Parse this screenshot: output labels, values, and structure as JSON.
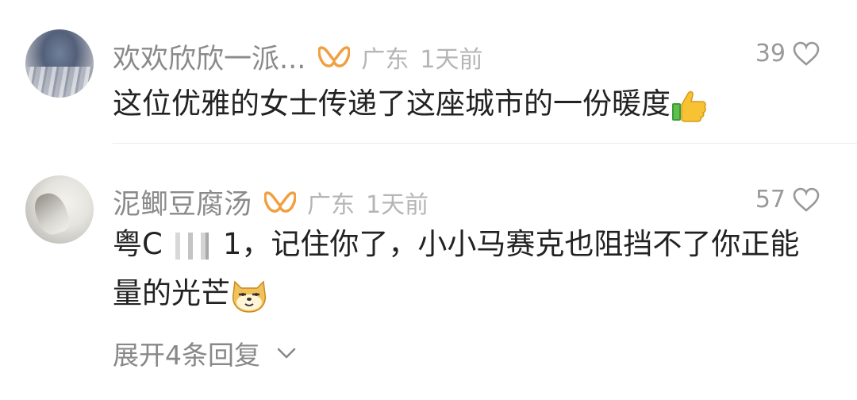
{
  "comments": [
    {
      "nickname": "欢欢欣欣一派...",
      "location": "广东",
      "time": "1天前",
      "likes": "39",
      "content": "这位优雅的女士传递了这座城市的一份暖度",
      "emoji": "thumbs-up-icon"
    },
    {
      "nickname": "泥鲫豆腐汤",
      "location": "广东",
      "time": "1天前",
      "likes": "57",
      "content_prefix": "粤C",
      "content_suffix": "1，记住你了，小小马赛克也阻挡不了你正能量的光芒",
      "emoji": "doge-icon",
      "expand_label": "展开4条回复"
    }
  ],
  "colors": {
    "badge": "#f0a040",
    "meta": "#b5b5b5",
    "text": "#222222"
  }
}
